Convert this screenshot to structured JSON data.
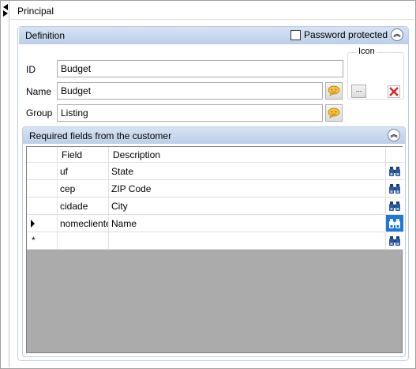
{
  "tab": {
    "title": "Principal"
  },
  "definition": {
    "header_title": "Definition",
    "password_protected_label": "Password protected",
    "password_protected_checked": false,
    "id_label": "ID",
    "id_value": "Budget",
    "name_label": "Name",
    "name_value": "Budget",
    "group_label": "Group",
    "group_value": "Listing",
    "icon_group_label": "Icon",
    "browse_button_label": "..."
  },
  "required_fields": {
    "header_title": "Required fields from the customer",
    "columns": [
      "Field",
      "Description"
    ],
    "rows": [
      {
        "field": "uf",
        "description": "State"
      },
      {
        "field": "cep",
        "description": "ZIP Code"
      },
      {
        "field": "cidade",
        "description": "City"
      },
      {
        "field": "nomecliente",
        "description": "Name"
      }
    ],
    "new_row_marker": "*"
  },
  "colors": {
    "header_gradient_top": "#d6e3f3",
    "header_gradient_bottom": "#bccfe9",
    "grid_background": "#ababab",
    "active_button": "#1e78d6",
    "delete_red": "#e02020"
  },
  "icons": {
    "expand_toggle": "triangle-arrows-icon",
    "collapse": "double-chevron-up-icon",
    "emoji": "speech-bubble-emoji-icon",
    "delete": "red-x-icon",
    "lookup": "binoculars-icon"
  }
}
